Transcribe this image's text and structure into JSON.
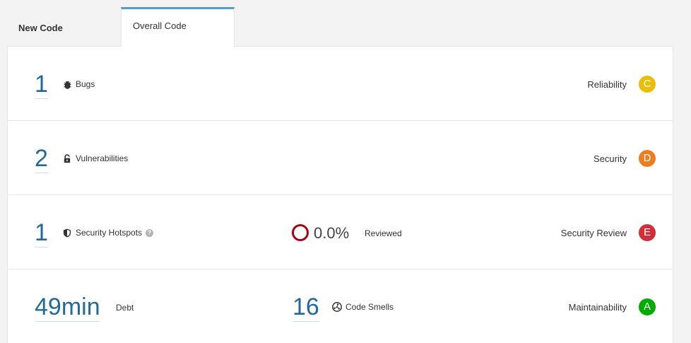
{
  "tabs": [
    {
      "label": "New Code"
    },
    {
      "label": "Overall Code"
    }
  ],
  "rows": {
    "reliability": {
      "count": "1",
      "metric": "Bugs",
      "rating_label": "Reliability",
      "rating": "C",
      "rating_color": "#eabe06"
    },
    "security": {
      "count": "2",
      "metric": "Vulnerabilities",
      "rating_label": "Security",
      "rating": "D",
      "rating_color": "#ed7d20"
    },
    "hotspots": {
      "count": "1",
      "metric": "Security Hotspots",
      "help": "?",
      "reviewed_pct": "0.0%",
      "reviewed_label": "Reviewed",
      "rating_label": "Security Review",
      "rating": "E",
      "rating_color": "#d02f3a"
    },
    "maintainability": {
      "debt": "49min",
      "debt_label": "Debt",
      "smells_count": "16",
      "smells_label": "Code Smells",
      "rating_label": "Maintainability",
      "rating": "A",
      "rating_color": "#00aa00"
    }
  }
}
